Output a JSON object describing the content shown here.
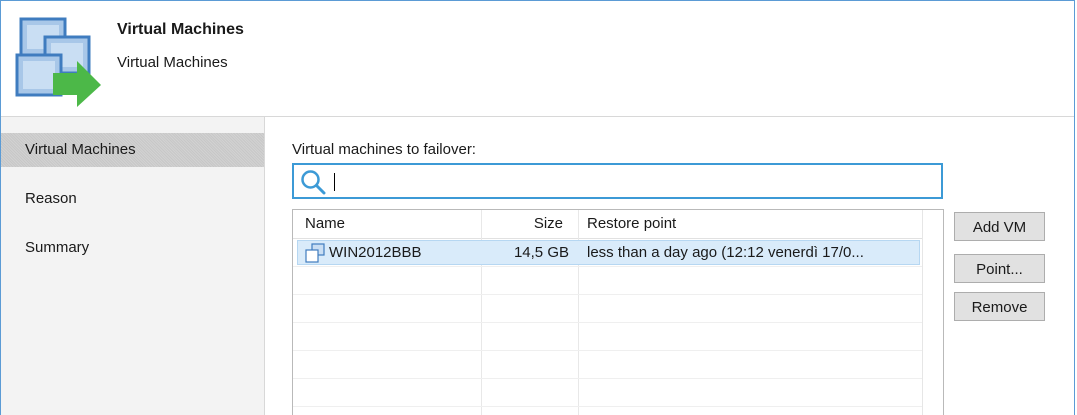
{
  "header": {
    "title": "Virtual Machines",
    "subtitle": "Virtual Machines",
    "icon": "vm-migrate-icon"
  },
  "sidebar": {
    "items": [
      {
        "label": "Virtual Machines",
        "selected": true
      },
      {
        "label": "Reason",
        "selected": false
      },
      {
        "label": "Summary",
        "selected": false
      }
    ]
  },
  "main": {
    "section_label": "Virtual machines to failover:",
    "search": {
      "value": "",
      "placeholder": ""
    },
    "table": {
      "columns": [
        "Name",
        "Size",
        "Restore point"
      ],
      "rows": [
        {
          "name": "WIN2012BBB",
          "size": "14,5 GB",
          "restore_point": "less than a day ago (12:12 venerdì 17/0...",
          "selected": true
        }
      ]
    },
    "buttons": {
      "add_vm": "Add VM",
      "point": "Point...",
      "remove": "Remove"
    }
  },
  "colors": {
    "accent_blue": "#3c9ad6",
    "selection_bg": "#d9ebfa",
    "sidebar_bg": "#f3f3f3",
    "icon_green": "#4cb848"
  }
}
